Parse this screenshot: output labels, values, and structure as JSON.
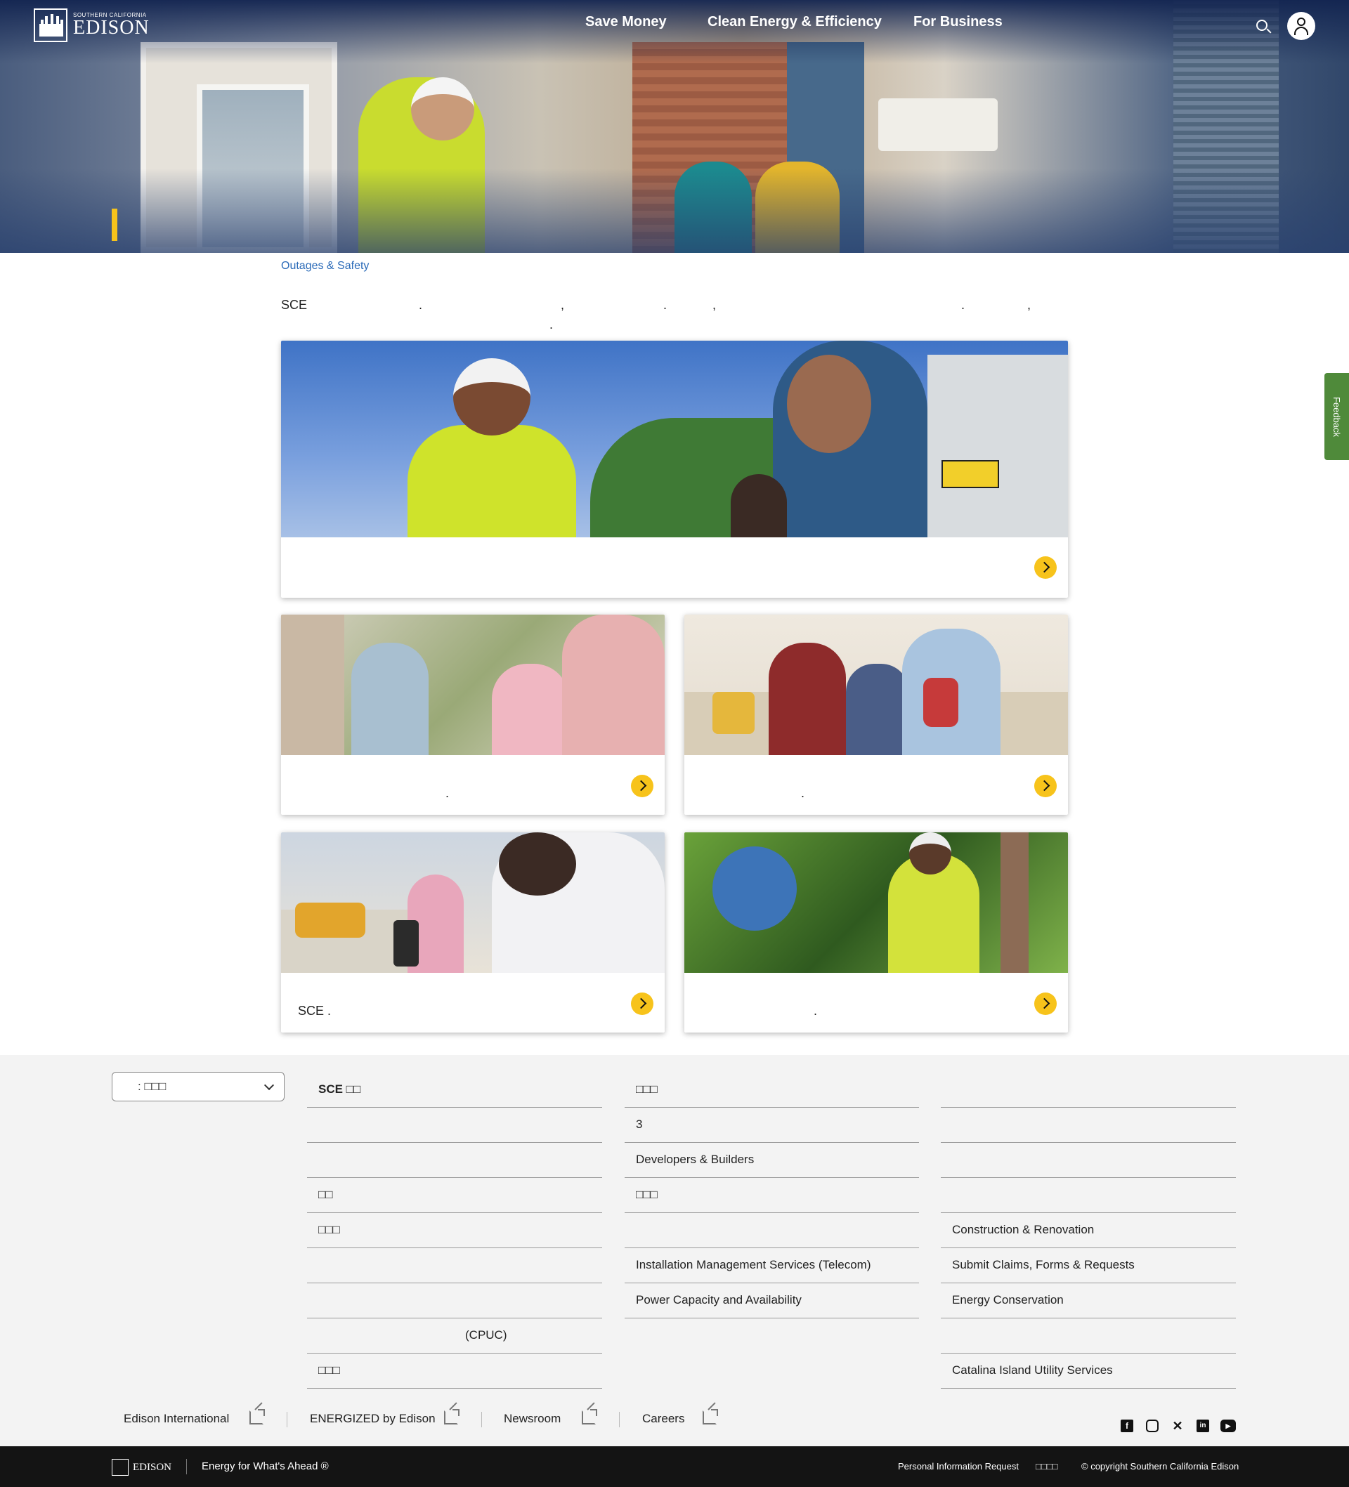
{
  "header": {
    "logo_small": "SOUTHERN CALIFORNIA",
    "logo_big": "EDISON",
    "nav": [
      {
        "label": "Save Money"
      },
      {
        "label": "Clean Energy & Efficiency"
      },
      {
        "label": "For Business"
      }
    ],
    "icons": {
      "search": "search-icon",
      "account": "user-icon"
    }
  },
  "breadcrumb": "Outages & Safety",
  "intro": {
    "lead": "SCE",
    "punctuation": [
      ".",
      ",",
      ".",
      ",",
      ".",
      ",",
      "."
    ]
  },
  "cards": [
    {
      "label": ""
    },
    {
      "label": "."
    },
    {
      "label": "."
    },
    {
      "label": "SCE                              ."
    },
    {
      "label": "."
    }
  ],
  "feedback_label": "Feedback",
  "footer": {
    "language_select": ": □□□",
    "col1": [
      "SCE □□",
      "",
      "",
      "□□",
      "□□□",
      "",
      "",
      "(CPUC)",
      "□□□"
    ],
    "col2": [
      "□□□",
      "3",
      "Developers & Builders",
      "□□□",
      "",
      "Installation Management Services (Telecom)",
      "Power Capacity and Availability"
    ],
    "col3": [
      "",
      "",
      "",
      "",
      "Construction & Renovation",
      "Submit Claims, Forms & Requests",
      "Energy Conservation",
      "",
      "Catalina Island Utility Services"
    ],
    "external_links": [
      "Edison International",
      "ENERGIZED by Edison",
      "Newsroom",
      "Careers"
    ],
    "social": [
      "facebook-icon",
      "instagram-icon",
      "x-icon",
      "linkedin-icon",
      "youtube-icon"
    ],
    "bottom": {
      "logo_text": "EDISON",
      "tagline": "Energy for What's Ahead ®",
      "links": [
        "Personal Information Request",
        "□□□□",
        "© copyright Southern California Edison"
      ]
    }
  },
  "colors": {
    "accent_yellow": "#f7c31b",
    "link_blue": "#2a6ab8",
    "feedback_green": "#4f8a3a",
    "footer_bg": "#f3f3f3",
    "bottom_bar": "#141414"
  }
}
